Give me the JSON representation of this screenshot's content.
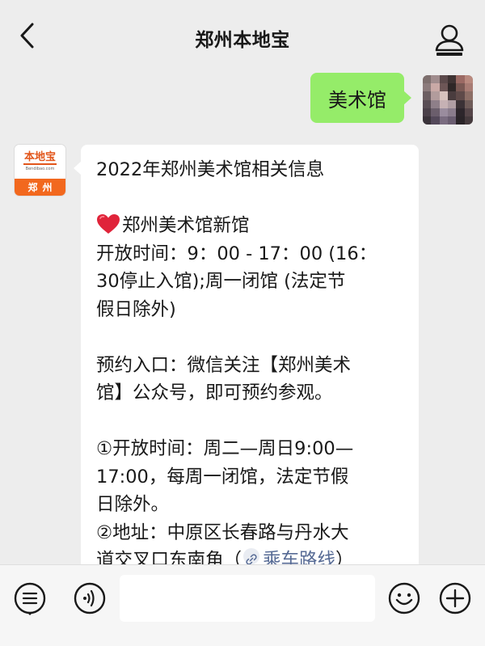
{
  "header": {
    "title": "郑州本地宝",
    "back_icon": "chevron-left-icon",
    "profile_icon": "person-icon"
  },
  "outgoing_message": {
    "text": "美术馆",
    "bubble_color": "#95ec69"
  },
  "bot": {
    "logo_text": "本地宝",
    "logo_subtext": "Bendibao.com",
    "logo_city": "郑州",
    "brand_color": "#f2681e"
  },
  "incoming_message": {
    "title": "2022年郑州美术馆相关信息",
    "venue_name": "郑州美术馆新馆",
    "hours_line1": "开放时间：9：00 - 17：00 (16：",
    "hours_line2": "30停止入馆);周一闭馆 (法定节",
    "hours_line3": "假日除外)",
    "reserve_line1": "预约入口：微信关注【郑州美术",
    "reserve_line2": "馆】公众号，即可预约参观。",
    "item1_line1": "①开放时间：周二—周日9:00—",
    "item1_line2": "17:00，每周一闭馆，法定节假",
    "item1_line3": "日除外。",
    "item2_line1": "②地址：中原区长春路与丹水大",
    "item2_line2_prefix": "道交叉口东南角（",
    "route_link_label": "乘车路线",
    "item2_line2_suffix": "）",
    "heart_icon": "heart-icon",
    "link_color": "#576b95"
  },
  "input_bar": {
    "menu_icon": "menu-list-icon",
    "voice_icon": "voice-icon",
    "input_value": "",
    "emoji_icon": "emoji-icon",
    "plus_icon": "plus-icon"
  }
}
